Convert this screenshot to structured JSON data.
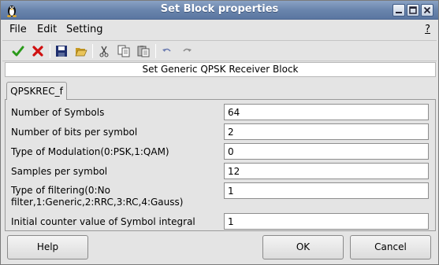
{
  "window": {
    "title": "Set Block properties"
  },
  "menu": {
    "file": "File",
    "edit": "Edit",
    "setting": "Setting",
    "help": "?"
  },
  "toolbar": {
    "icons": [
      "check-icon",
      "cross-icon",
      "save-icon",
      "open-folder-icon",
      "cut-icon",
      "copy-icon",
      "paste-icon",
      "undo-icon",
      "redo-icon"
    ]
  },
  "heading": "Set Generic QPSK Receiver Block",
  "tab": {
    "label": "QPSKREC_f"
  },
  "params": [
    {
      "label": "Number of Symbols",
      "value": "64"
    },
    {
      "label": "Number of bits per symbol",
      "value": "2"
    },
    {
      "label": "Type of Modulation(0:PSK,1:QAM)",
      "value": "0"
    },
    {
      "label": "Samples per symbol",
      "value": "12"
    },
    {
      "label_line1": "Type of filtering(0:No",
      "label_line2": "filter,1:Generic,2:RRC,3:RC,4:Gauss)",
      "value": "1"
    },
    {
      "label": "Initial counter value of Symbol integral",
      "value": "1"
    }
  ],
  "buttons": {
    "help": "Help",
    "ok": "OK",
    "cancel": "Cancel"
  },
  "colors": {
    "title_bar": "#6a85ad",
    "accept_green": "#2a9a1a",
    "reject_red": "#d01010"
  }
}
